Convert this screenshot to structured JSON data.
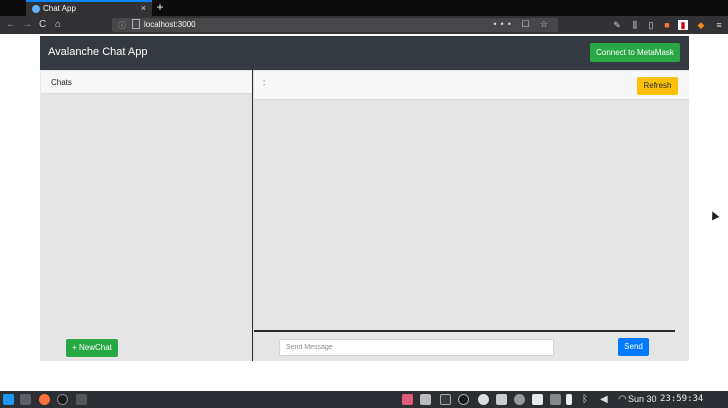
{
  "browser": {
    "tab_title": "Chat App",
    "tab_close": "×",
    "new_tab": "+",
    "url": "localhost:3000",
    "back": "←",
    "forward": "→",
    "reload": "C",
    "home": "⌂",
    "url_actions": "••• ☐ ☆"
  },
  "app": {
    "brand": "Avalanche Chat App",
    "connect_button": "Connect to MetaMask",
    "chats_label": "Chats",
    "conversation_title": ":",
    "refresh_button": "Refresh",
    "new_chat_button": "+ NewChat",
    "message_placeholder": "Send Message",
    "send_button": "Send"
  },
  "taskbar": {
    "date": "Sun 30",
    "time": "23:59:34"
  },
  "colors": {
    "navbar": "#343a40",
    "success": "#28a745",
    "warning": "#ffc107",
    "primary": "#007bff",
    "panel_bg": "#e5e5e5"
  }
}
